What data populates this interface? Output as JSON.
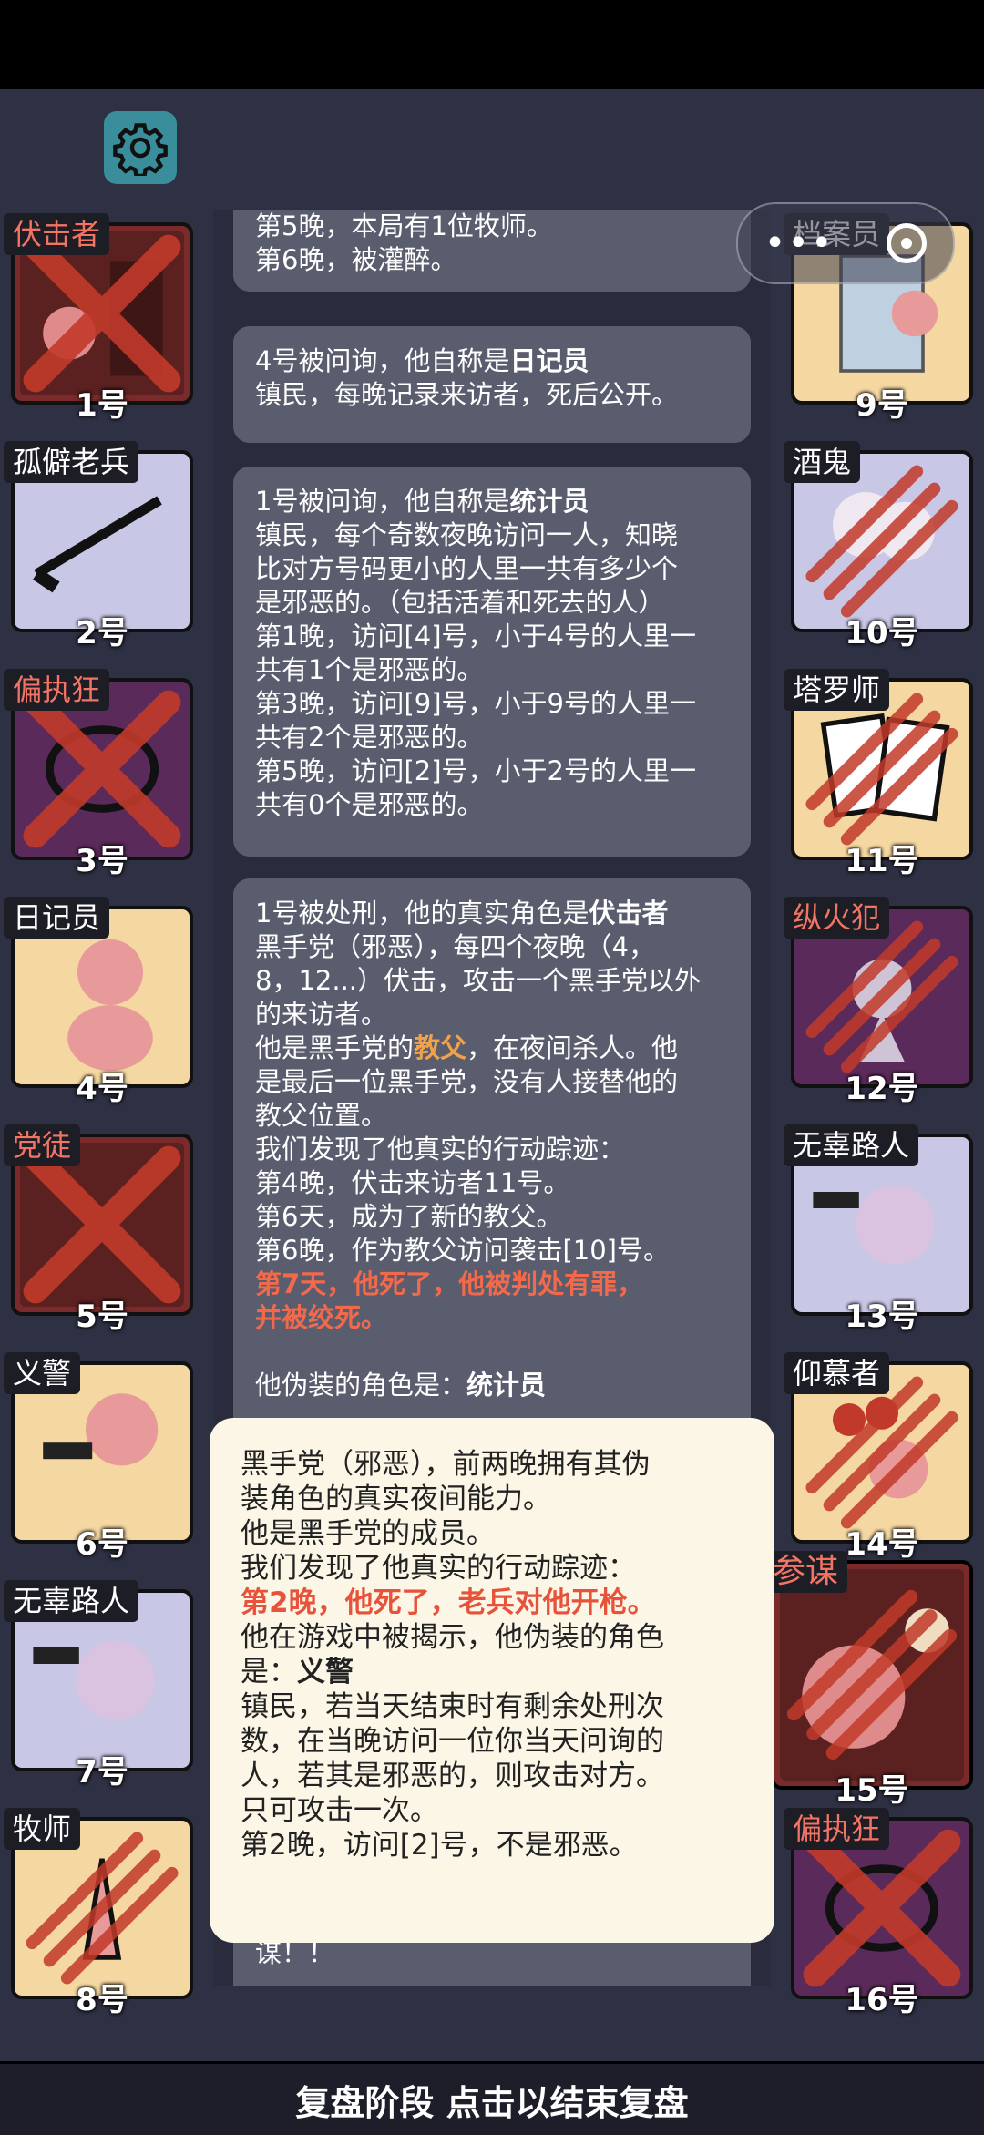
{
  "footer": {
    "text": "复盘阶段 点击以结束复盘"
  },
  "log": {
    "bubble1": {
      "line1": "第5晚，本局有1位牧师。",
      "line2": "第6晚，被灌醉。"
    },
    "bubble2": {
      "intro": "4号被问询，他自称是",
      "role": "日记员",
      "desc": "镇民，每晚记录来访者，死后公开。"
    },
    "bubble3": {
      "intro": "1号被问询，他自称是",
      "role": "统计员",
      "lines": [
        "镇民，每个奇数夜晚访问一人，知晓",
        "比对方号码更小的人里一共有多少个",
        "是邪恶的。（包括活着和死去的人）",
        "第1晚，访问[4]号，小于4号的人里一",
        "共有1个是邪恶的。",
        "第3晚，访问[9]号，小于9号的人里一",
        "共有2个是邪恶的。",
        "第5晚，访问[2]号，小于2号的人里一",
        "共有0个是邪恶的。"
      ]
    },
    "bubble4": {
      "intro": "1号被处刑，他的真实角色是",
      "role": "伏击者",
      "l1": "黑手党（邪恶），每四个夜晚（4，",
      "l2": "8，12...）伏击，攻击一个黑手党以外",
      "l3": "的来访者。",
      "l4a": "他是黑手党的",
      "l4b": "教父",
      "l4c": "，在夜间杀人。他",
      "l5": "是最后一位黑手党，没有人接替他的",
      "l6": "教父位置。",
      "l7": "我们发现了他真实的行动踪迹：",
      "l8": "第4晚，伏击来访者11号。",
      "l9": "第6天，成为了新的教父。",
      "l10": "第6晚，作为教父访问袭击[10]号。",
      "death1": "第7天，他死了，他被判处有罪，",
      "death2": "并被绞死。",
      "fake_intro": "他伪装的角色是：",
      "fake_role": "统计员"
    },
    "tail": "谋！！"
  },
  "popup": {
    "l1": "黑手党（邪恶），前两晚拥有其伪",
    "l2": "装角色的真实夜间能力。",
    "l3": "他是黑手党的成员。",
    "l4": "我们发现了他真实的行动踪迹：",
    "death": "第2晚，他死了，老兵对他开枪。",
    "l6": "他在游戏中被揭示，他伪装的角色",
    "l7a": "是：",
    "l7b": "义警",
    "l8": "镇民，若当天结束时有剩余处刑次",
    "l9": "数，在当晚访问一位你当天问询的",
    "l10": "人，若其是邪恶的，则攻击对方。",
    "l11": "只可攻击一次。",
    "l12": "第2晚，访问[2]号，不是邪恶。"
  },
  "players": {
    "p1": {
      "role": "伏击者",
      "num": "1号",
      "dead": true
    },
    "p2": {
      "role": "孤僻老兵",
      "num": "2号",
      "dead": false
    },
    "p3": {
      "role": "偏执狂",
      "num": "3号",
      "dead": true
    },
    "p4": {
      "role": "日记员",
      "num": "4号",
      "dead": false
    },
    "p5": {
      "role": "党徒",
      "num": "5号",
      "dead": true
    },
    "p6": {
      "role": "义警",
      "num": "6号",
      "dead": false
    },
    "p7": {
      "role": "无辜路人",
      "num": "7号",
      "dead": false
    },
    "p8": {
      "role": "牧师",
      "num": "8号",
      "dead": true
    },
    "p9": {
      "role": "档案员",
      "num": "9号",
      "dead": false
    },
    "p10": {
      "role": "酒鬼",
      "num": "10号",
      "dead": true
    },
    "p11": {
      "role": "塔罗师",
      "num": "11号",
      "dead": true
    },
    "p12": {
      "role": "纵火犯",
      "num": "12号",
      "dead": true
    },
    "p13": {
      "role": "无辜路人",
      "num": "13号",
      "dead": false
    },
    "p14": {
      "role": "仰慕者",
      "num": "14号",
      "dead": true
    },
    "p15": {
      "role": "参谋",
      "num": "15号",
      "dead": true
    },
    "p16": {
      "role": "偏执狂",
      "num": "16号",
      "dead": true
    }
  },
  "colors": {
    "blood": "#c23a2a",
    "highlight_red": "#f26a4b",
    "evil_label": "#f27465",
    "popup_bg": "#fbf6e6"
  }
}
